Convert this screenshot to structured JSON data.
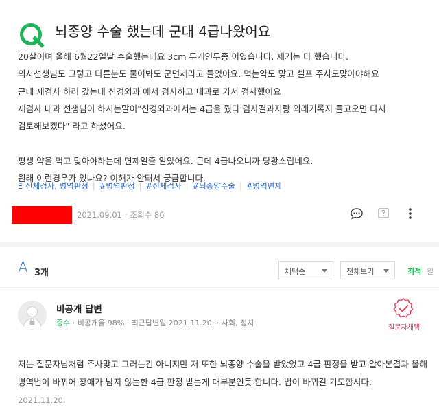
{
  "question": {
    "title": "뇌종양 수술 했는데 군대 4급나왔어요",
    "lines": [
      "20살이며 올해 6월22일날 수술했는데요 3cm 두개인두종 이였습니다. 제거는 다 했습니다.",
      "의사선생님도 그렇고 다른분도 물어봐도 군면제라고 들었어요. 먹는약도 맞고 셀프 주사도맞아야해요",
      "근데 재검사 하러 갔는데 신경외과 에서 검사하고 내과로 가서 검사했어요",
      "재검사 내과 선생님이 하시는말이\"신경외과에서는 4급을 줬다 검사결과지랑 외래기록지 들고오면 다시",
      "검토해보겠다\" 라고 하셨어요.",
      "",
      "평생 약을 먹고 맞아야하는데 면제일줄 알았어요. 근데 4급나오니까 당황스럽네요.",
      "원래 이런경우가 있나요? 이해가 안돼서 궁금합니다."
    ],
    "category": "신체검사, 병역판정",
    "tags": [
      "#병역판정",
      "#신체검사",
      "#뇌종양수술",
      "#병역면제"
    ],
    "date": "2021.09.01",
    "views": "조회수 86"
  },
  "answers_header": {
    "letter": "A",
    "count": "3개",
    "filter_order": "채택순",
    "filter_view": "전체보기",
    "sort_latest": "최적",
    "sort_other": "원"
  },
  "answer": {
    "name": "비공개 답변",
    "grade": "중수",
    "stats": "비공개율 98%",
    "recent": "최근답변일 2021.11.20.",
    "field": "사회, 정치",
    "adopt_label": "질문자채택",
    "lines": [
      "저는 질문자님처럼 주사맞고 그러는건 아니지만 저 또한 뇌종양 수술을 받았었고 4급 판정을 받고 알아본결과 올해",
      "병역법이 바뀌어 장애가 남지 않는한 4급 판정 받는게 대부분인듯 합니다. 법이 바뀌길 기도합시다."
    ],
    "date": "2021.11.20."
  },
  "colors": {
    "brand_green": "#1fb35a",
    "link_blue": "#2f6bc9",
    "adopt_red": "#e0455c"
  }
}
